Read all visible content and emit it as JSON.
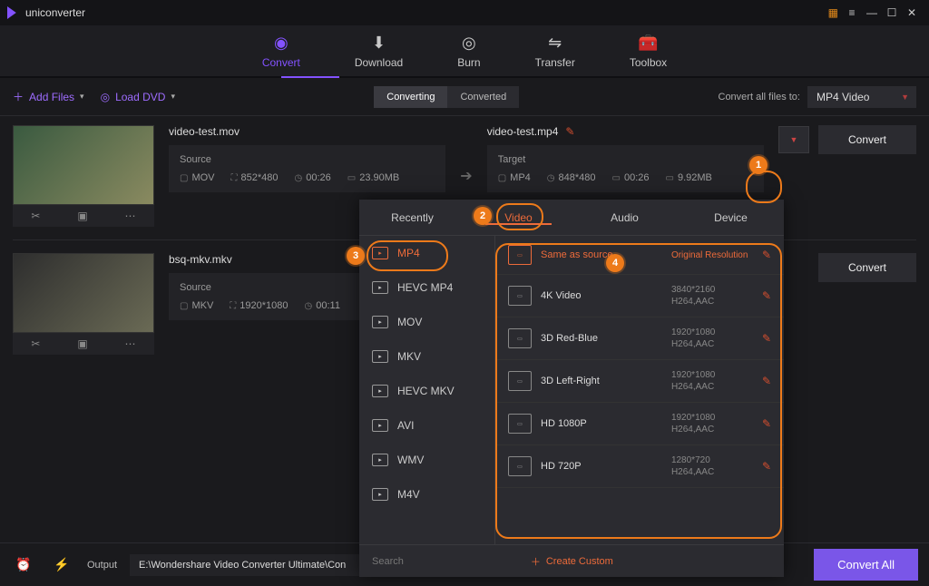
{
  "app": {
    "title": "uniconverter"
  },
  "nav": {
    "convert": "Convert",
    "download": "Download",
    "burn": "Burn",
    "transfer": "Transfer",
    "toolbox": "Toolbox"
  },
  "toolbar": {
    "add_files": "Add Files",
    "load_dvd": "Load DVD",
    "converting": "Converting",
    "converted": "Converted",
    "convert_all_to": "Convert all files to:",
    "format_selected": "MP4 Video"
  },
  "files": [
    {
      "source_name": "video-test.mov",
      "target_name": "video-test.mp4",
      "source": {
        "label": "Source",
        "container": "MOV",
        "resolution": "852*480",
        "duration": "00:26",
        "size": "23.90MB"
      },
      "target": {
        "label": "Target",
        "container": "MP4",
        "resolution": "848*480",
        "duration": "00:26",
        "size": "9.92MB"
      },
      "convert": "Convert"
    },
    {
      "source_name": "bsq-mkv.mkv",
      "source": {
        "label": "Source",
        "container": "MKV",
        "resolution": "1920*1080",
        "duration": "00:11"
      },
      "convert": "Convert"
    }
  ],
  "popup": {
    "tabs": {
      "recently": "Recently",
      "video": "Video",
      "audio": "Audio",
      "device": "Device"
    },
    "formats": [
      "MP4",
      "HEVC MP4",
      "MOV",
      "MKV",
      "HEVC MKV",
      "AVI",
      "WMV",
      "M4V"
    ],
    "presets": [
      {
        "name": "Same as source",
        "sub1": "Original Resolution",
        "sub2": "",
        "hi": true
      },
      {
        "name": "4K Video",
        "sub1": "3840*2160",
        "sub2": "H264,AAC"
      },
      {
        "name": "3D Red-Blue",
        "sub1": "1920*1080",
        "sub2": "H264,AAC"
      },
      {
        "name": "3D Left-Right",
        "sub1": "1920*1080",
        "sub2": "H264,AAC"
      },
      {
        "name": "HD 1080P",
        "sub1": "1920*1080",
        "sub2": "H264,AAC"
      },
      {
        "name": "HD 720P",
        "sub1": "1280*720",
        "sub2": "H264,AAC"
      }
    ],
    "search_placeholder": "Search",
    "create_custom": "Create Custom"
  },
  "bottom": {
    "output_label": "Output",
    "output_path": "E:\\Wondershare Video Converter Ultimate\\Con",
    "convert_all": "Convert All"
  }
}
